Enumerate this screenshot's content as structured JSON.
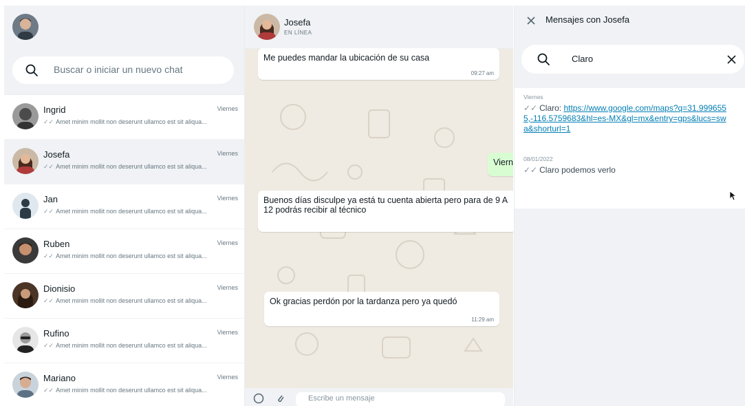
{
  "sidebar": {
    "search_placeholder": "Buscar o iniciar un nuevo chat",
    "chats": [
      {
        "name": "Ingrid",
        "time": "Viernes",
        "preview": "Amet minim mollit non deserunt ullamco est sit aliqua...",
        "avatar_color": "#5a5a5a"
      },
      {
        "name": "Josefa",
        "time": "Viernes",
        "preview": "Amet minim mollit non deserunt ullamco est sit aliqua...",
        "avatar_color": "#b03b3b"
      },
      {
        "name": "Jan",
        "time": "Viernes",
        "preview": "Amet minim mollit non deserunt ullamco est sit aliqua...",
        "avatar_color": "#6c8ca4"
      },
      {
        "name": "Ruben",
        "time": "Viernes",
        "preview": "Amet minim mollit non deserunt ullamco est sit aliqua...",
        "avatar_color": "#8a5a3c"
      },
      {
        "name": "Dionisio",
        "time": "Viernes",
        "preview": "Amet minim mollit non deserunt ullamco est sit aliqua...",
        "avatar_color": "#6b4a32"
      },
      {
        "name": "Rufino",
        "time": "Viernes",
        "preview": "Amet minim mollit non deserunt ullamco est sit aliqua...",
        "avatar_color": "#7a7a7a"
      },
      {
        "name": "Mariano",
        "time": "Viernes",
        "preview": "Amet minim mollit non deserunt ullamco est sit aliqua...",
        "avatar_color": "#8c9aa8"
      }
    ]
  },
  "chat": {
    "contact_name": "Josefa",
    "contact_status": "EN LÍNEA",
    "messages": [
      {
        "text": "Me puedes mandar la ubicación de su casa",
        "time": "09:27 am",
        "direction": "in"
      },
      {
        "text": "Viern",
        "time": "",
        "direction": "out"
      },
      {
        "text": "Buenos días disculpe ya está tu cuenta abierta pero para de 9 A 12 podrás recibir al técnico",
        "time": "",
        "direction": "in"
      },
      {
        "text": "Ok gracias perdón por la tardanza pero ya quedó",
        "time": "11:29 am",
        "direction": "in"
      }
    ],
    "input_placeholder": "Escribe un mensaje"
  },
  "search_panel": {
    "title": "Mensajes con Josefa",
    "query": "Claro",
    "results": [
      {
        "date": "Viernes",
        "prefix": "Claro: ",
        "link": "https://www.google.com/maps?q=31.9996555,-116.5759683&hl=es-MX&gl=mx&entry=gps&lucs=swa&shorturl=1"
      },
      {
        "date": "08/01/2022",
        "prefix": "Claro podemos verlo",
        "link": ""
      }
    ]
  },
  "colors": {
    "panel_bg": "#f0f2f5",
    "chat_bg": "#efeae2",
    "link": "#027eb5",
    "tick": "#8696a0"
  }
}
